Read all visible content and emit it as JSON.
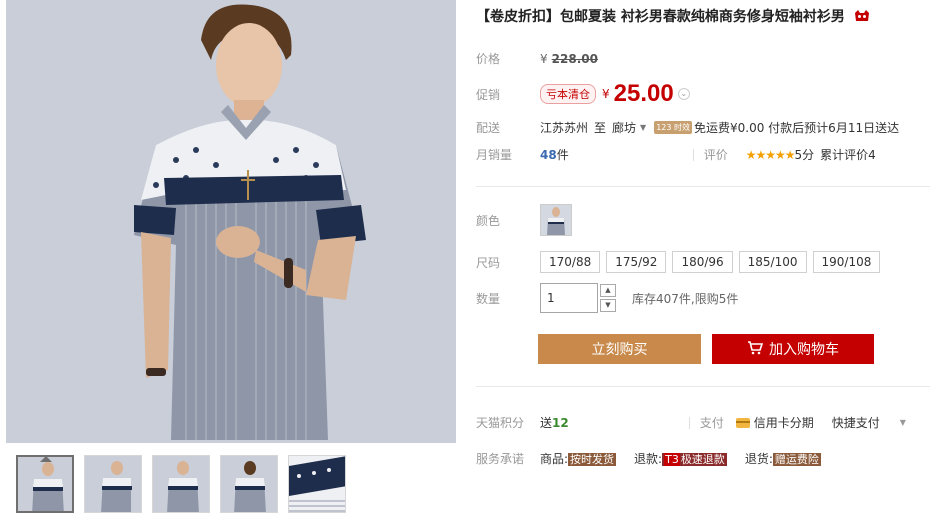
{
  "product": {
    "title": "【卷皮折扣】包邮夏装 衬衫男春款纯棉商务修身短袖衬衫男",
    "title_icon": "tmall-cat-icon"
  },
  "price": {
    "label": "价格",
    "currency": "¥",
    "original": "228.00"
  },
  "promo": {
    "label": "促销",
    "tag": "亏本清仓",
    "currency": "¥",
    "price": "25.00"
  },
  "shipping": {
    "label": "配送",
    "from": "江苏苏州",
    "to_word": "至",
    "destination": "廊坊",
    "badge": "123 时效",
    "note": "免运费¥0.00 付款后预计6月11日送达"
  },
  "sales": {
    "label": "月销量",
    "count": "48",
    "unit": "件",
    "rating_label": "评价",
    "stars": "★★★★★",
    "score": "5分",
    "reviews": "累计评价4"
  },
  "color": {
    "label": "颜色"
  },
  "size": {
    "label": "尺码",
    "options": [
      "170/88",
      "175/92",
      "180/96",
      "185/100",
      "190/108"
    ]
  },
  "quantity": {
    "label": "数量",
    "value": "1",
    "stock": "库存407件,限购5件"
  },
  "actions": {
    "buy_now": "立刻购买",
    "add_cart": "加入购物车"
  },
  "points": {
    "label": "天猫积分",
    "prefix": "送",
    "value": "12"
  },
  "payment": {
    "label": "支付",
    "credit": "信用卡分期",
    "quick": "快捷支付"
  },
  "service": {
    "label": "服务承诺",
    "goods_label": "商品:",
    "goods_badge": "按时发货",
    "refund_label": "退款:",
    "refund_t3": "T3",
    "refund_badge": "极速退款",
    "return_label": "退货:",
    "return_badge": "赠运费险"
  },
  "colors": {
    "accent_red": "#c40000",
    "buy_now_bg": "#c8894a",
    "sales_blue": "#3a6ab0",
    "points_green": "#3b8a30",
    "star_orange": "#f3a000"
  }
}
